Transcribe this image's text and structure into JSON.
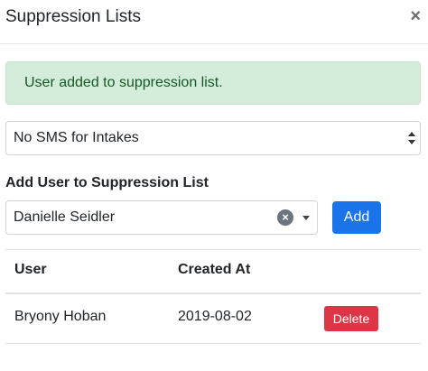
{
  "modal": {
    "title": "Suppression Lists",
    "close_glyph": "×"
  },
  "alert": {
    "message": "User added to suppression list."
  },
  "list_select": {
    "selected": "No SMS for Intakes"
  },
  "add_user": {
    "label": "Add User to Suppression List",
    "selected_user": "Danielle Seidler",
    "clear_glyph": "×",
    "button_label": "Add"
  },
  "table": {
    "columns": [
      "User",
      "Created At"
    ],
    "rows": [
      {
        "user": "Bryony Hoban",
        "created_at": "2019-08-02",
        "action": "Delete"
      }
    ]
  },
  "colors": {
    "primary": "#1a73e8",
    "danger": "#dc3545",
    "success_bg": "#d4edda",
    "success_text": "#155724"
  }
}
